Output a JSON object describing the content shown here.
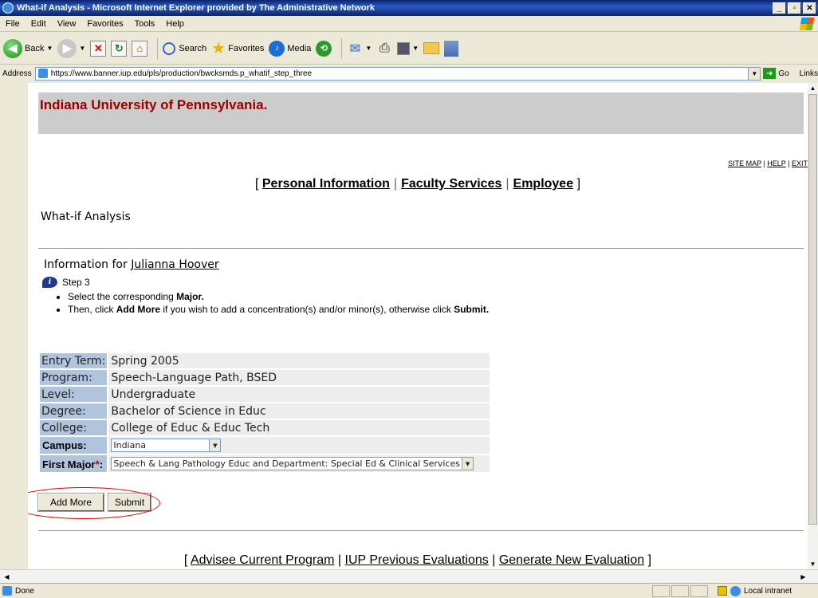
{
  "window": {
    "title": "What-if Analysis - Microsoft Internet Explorer provided by The Administrative Network"
  },
  "menu": [
    "File",
    "Edit",
    "View",
    "Favorites",
    "Tools",
    "Help"
  ],
  "toolbar": {
    "back": "Back",
    "search": "Search",
    "favorites": "Favorites",
    "media": "Media"
  },
  "address": {
    "label": "Address",
    "url": "https://www.banner.iup.edu/pls/production/bwcksmds.p_whatif_step_three",
    "go": "Go",
    "links": "Links"
  },
  "page": {
    "banner": "Indiana University of Pennsylvania.",
    "toplinks": {
      "sitemap": "SITE MAP",
      "help": "HELP",
      "exit": "EXIT"
    },
    "nav": {
      "open": "[",
      "personal": "Personal Information",
      "faculty": "Faculty Services",
      "employee": "Employee",
      "close": "]"
    },
    "title": "What-if Analysis",
    "info_prefix": "Information for",
    "student": "Julianna Hoover",
    "step": "Step 3",
    "bullet1_pre": "Select the corresponding",
    "bullet1_bold": "Major.",
    "bullet2_pre": "Then, click",
    "bullet2_bold1": "Add More",
    "bullet2_mid": "if you wish to add a concentration(s) and/or minor(s), otherwise click",
    "bullet2_bold2": "Submit.",
    "rows": [
      {
        "label": "Entry Term:",
        "value": "Spring 2005"
      },
      {
        "label": "Program:",
        "value": "Speech-Language Path, BSED"
      },
      {
        "label": "Level:",
        "value": "Undergraduate"
      },
      {
        "label": "Degree:",
        "value": "Bachelor of Science in Educ"
      },
      {
        "label": "College:",
        "value": "College of Educ & Educ Tech"
      }
    ],
    "campus_label": "Campus:",
    "campus_value": "Indiana",
    "major_label": "First Major",
    "major_value": "Speech & Lang Pathology Educ and Department: Special Ed & Clinical Services",
    "add_more": "Add More",
    "submit": "Submit",
    "bottom": {
      "open": "[",
      "current": "Advisee Current Program",
      "previous": "IUP Previous Evaluations",
      "generate": "Generate New Evaluation",
      "close": "]"
    }
  },
  "status": {
    "text": "Done",
    "zone": "Local intranet"
  }
}
